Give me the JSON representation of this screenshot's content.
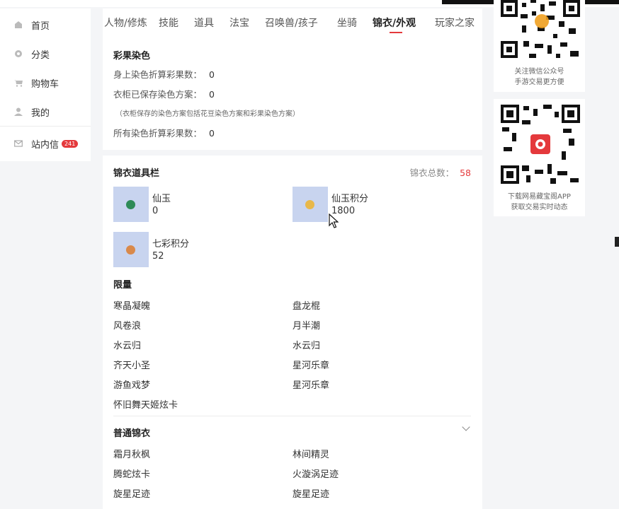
{
  "sidebar": {
    "items": [
      {
        "label": "首页",
        "icon": "home-icon"
      },
      {
        "label": "分类",
        "icon": "category-icon"
      },
      {
        "label": "购物车",
        "icon": "cart-icon"
      },
      {
        "label": "我的",
        "icon": "user-icon"
      }
    ],
    "inbox": {
      "label": "站内信",
      "icon": "mail-icon",
      "badge": "241"
    }
  },
  "tabs": [
    {
      "label": "人物/修炼"
    },
    {
      "label": "技能"
    },
    {
      "label": "道具"
    },
    {
      "label": "法宝"
    },
    {
      "label": "召唤兽/孩子"
    },
    {
      "label": "坐骑"
    },
    {
      "label": "锦衣/外观",
      "active": true
    },
    {
      "label": "玩家之家"
    }
  ],
  "dye": {
    "title": "彩果染色",
    "rows": [
      {
        "label": "身上染色折算彩果数：",
        "value": "0"
      },
      {
        "label": "衣柜已保存染色方案：",
        "value": "0"
      }
    ],
    "note": "（衣柜保存的染色方案包括花豆染色方案和彩果染色方案）",
    "total": {
      "label": "所有染色折算彩果数：",
      "value": "0"
    }
  },
  "items_panel": {
    "title": "锦衣道具栏",
    "total_label": "锦衣总数：",
    "total_value": "58",
    "props": [
      {
        "name": "仙玉",
        "value": "0",
        "color": "#2e8b57"
      },
      {
        "name": "仙玉积分",
        "value": "1800",
        "color": "#e8b84a"
      },
      {
        "name": "七彩积分",
        "value": "52",
        "color": "#d9894a"
      }
    ],
    "limited": {
      "title": "限量",
      "left": [
        "寒晶凝魄",
        "风卷浪",
        "水云归",
        "齐天小圣",
        "游鱼戏梦",
        "怀旧舞天姬炫卡"
      ],
      "right": [
        "盘龙棍",
        "月半潮",
        "水云归",
        "星河乐章",
        "星河乐章"
      ]
    },
    "normal": {
      "title": "普通锦衣",
      "left": [
        "霜月秋枫",
        "腾蛇炫卡",
        "旋星足迹"
      ],
      "right": [
        "林间精灵",
        "火漩涡足迹",
        "旋星足迹"
      ]
    }
  },
  "qr": [
    {
      "caption1": "关注微信公众号",
      "caption2": "手游交易更方便"
    },
    {
      "caption1": "下载网易藏宝阁APP",
      "caption2": "获取交易实时动态"
    }
  ],
  "colors": {
    "accent": "#e4393c",
    "thumb_bg": "#c8d4ef"
  }
}
